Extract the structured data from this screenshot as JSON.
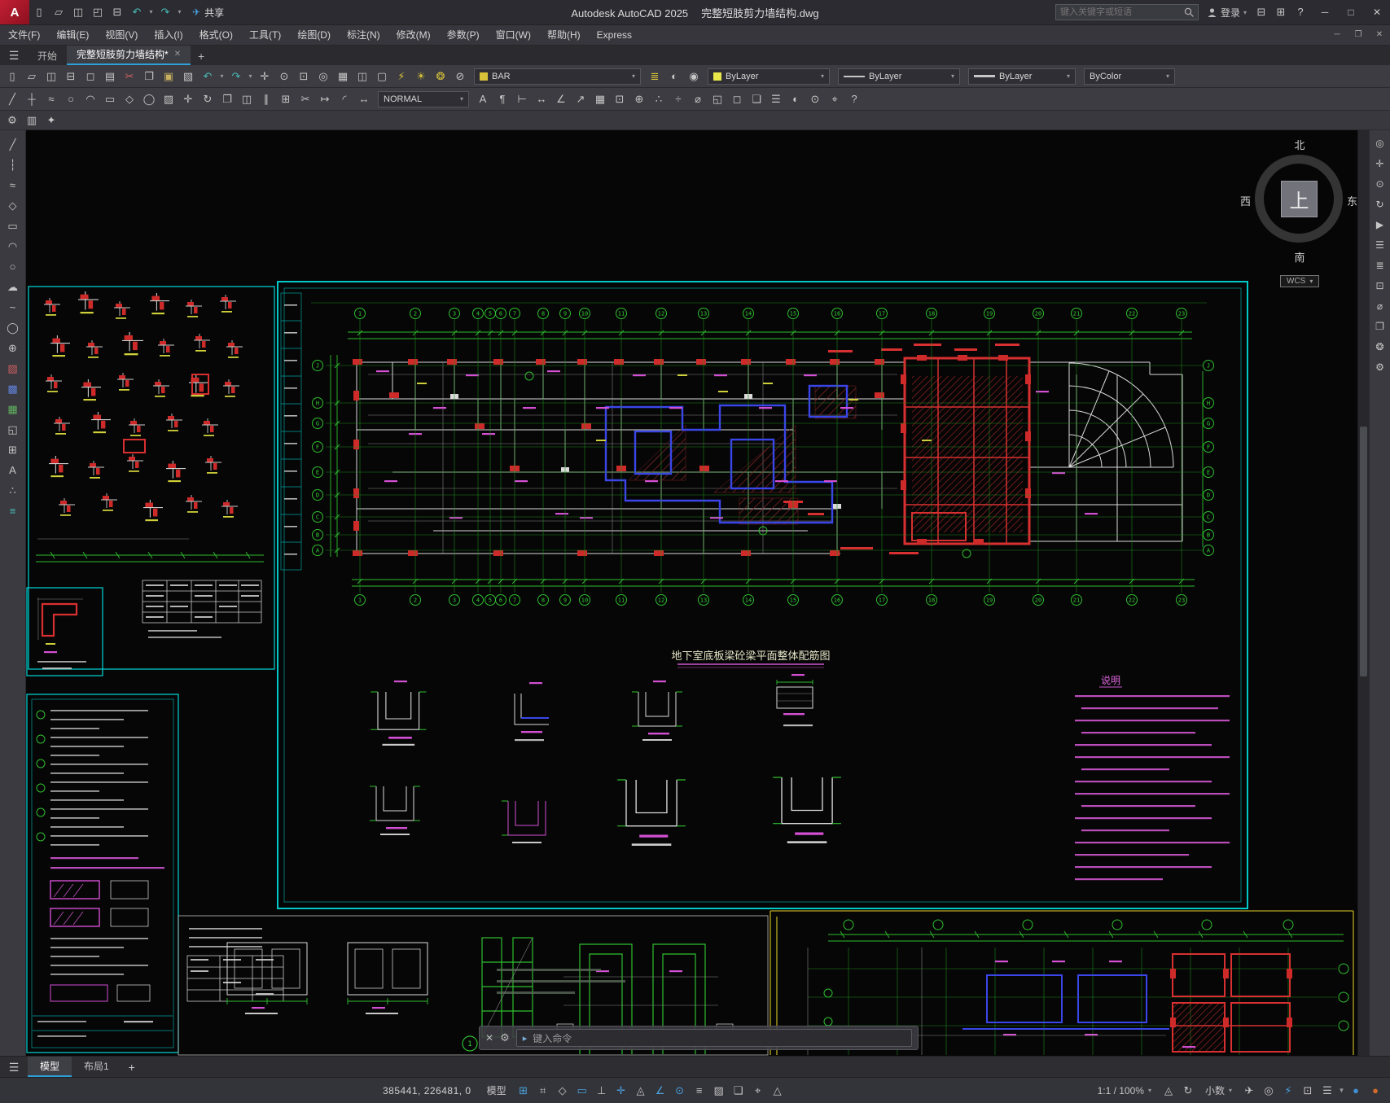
{
  "titlebar": {
    "logo": "A",
    "app_title": "Autodesk AutoCAD 2025",
    "doc_title": "完整短肢剪力墙结构.dwg",
    "share": "共享",
    "search_placeholder": "键入关键字或短语",
    "signin": "登录",
    "quick_icons": [
      {
        "name": "new-file-icon",
        "glyph": "▯"
      },
      {
        "name": "open-file-icon",
        "glyph": "▱"
      },
      {
        "name": "save-icon",
        "glyph": "◫"
      },
      {
        "name": "save-as-icon",
        "glyph": "◰"
      },
      {
        "name": "plot-icon",
        "glyph": "⊟"
      },
      {
        "name": "undo-icon",
        "glyph": "↶",
        "color": "#49b8b4"
      },
      {
        "name": "undo-dropdown-icon",
        "glyph": "▾",
        "small": true
      },
      {
        "name": "redo-icon",
        "glyph": "↷",
        "color": "#49b8b4"
      },
      {
        "name": "redo-dropdown-icon",
        "glyph": "▾",
        "small": true
      }
    ],
    "right_icons": [
      {
        "name": "cart-icon",
        "glyph": "⊟"
      },
      {
        "name": "apps-icon",
        "glyph": "⊞"
      },
      {
        "name": "help-icon",
        "glyph": "?"
      }
    ],
    "window_controls": [
      {
        "name": "minimize-button",
        "glyph": "─"
      },
      {
        "name": "maximize-button",
        "glyph": "□"
      },
      {
        "name": "close-button",
        "glyph": "✕"
      }
    ]
  },
  "menubar": {
    "items": [
      "文件(F)",
      "编辑(E)",
      "视图(V)",
      "插入(I)",
      "格式(O)",
      "工具(T)",
      "绘图(D)",
      "标注(N)",
      "修改(M)",
      "参数(P)",
      "窗口(W)",
      "帮助(H)",
      "Express"
    ],
    "window_controls": [
      {
        "name": "doc-minimize-button",
        "glyph": "─"
      },
      {
        "name": "doc-restore-button",
        "glyph": "❐"
      },
      {
        "name": "doc-close-button",
        "glyph": "✕"
      }
    ]
  },
  "doctabs": {
    "start_tab": "开始",
    "drawing_tab": "完整短肢剪力墙结构*",
    "close_glyph": "✕",
    "new_tab_glyph": "+"
  },
  "ribbon": {
    "row1_a": [
      {
        "name": "qnew-icon",
        "glyph": "▯"
      },
      {
        "name": "open-icon",
        "glyph": "▱"
      },
      {
        "name": "save-file-icon",
        "glyph": "◫"
      },
      {
        "name": "plot-icon",
        "glyph": "⊟"
      },
      {
        "name": "plot-preview-icon",
        "glyph": "◻"
      },
      {
        "name": "publish-icon",
        "glyph": "▤"
      },
      {
        "name": "cut-icon",
        "glyph": "✂",
        "color": "#d06060"
      },
      {
        "name": "copy-icon",
        "glyph": "❐"
      },
      {
        "name": "paste-icon",
        "glyph": "▣",
        "color": "#c8b060"
      },
      {
        "name": "match-properties-icon",
        "glyph": "▧"
      },
      {
        "name": "undo-icon",
        "glyph": "↶",
        "color": "#49b8b4"
      },
      {
        "name": "undo-list-icon",
        "glyph": "▾",
        "small": true
      },
      {
        "name": "redo-icon",
        "glyph": "↷",
        "color": "#49b8b4"
      },
      {
        "name": "redo-list-icon",
        "glyph": "▾",
        "small": true
      },
      {
        "name": "pan-icon",
        "glyph": "✛"
      },
      {
        "name": "zoom-realtime-icon",
        "glyph": "⊙"
      },
      {
        "name": "zoom-window-icon",
        "glyph": "⊡"
      },
      {
        "name": "zoom-previous-icon",
        "glyph": "◎"
      },
      {
        "name": "named-views-icon",
        "glyph": "▦"
      },
      {
        "name": "viewports-icon",
        "glyph": "◫"
      },
      {
        "name": "hide-icon",
        "glyph": "▢"
      },
      {
        "name": "render-icon",
        "glyph": "⚡",
        "color": "#d8c23a"
      },
      {
        "name": "sun-properties-icon",
        "glyph": "☀",
        "color": "#d8c23a"
      },
      {
        "name": "materials-icon",
        "glyph": "❂",
        "color": "#d8c23a"
      },
      {
        "name": "lock-ui-icon",
        "glyph": "⊘"
      }
    ],
    "bar_combo": {
      "label": "BAR"
    },
    "row1_b": [
      {
        "name": "layer-properties-icon",
        "glyph": "≣",
        "color": "#d8c23a"
      },
      {
        "name": "layer-states-icon",
        "glyph": "◐"
      },
      {
        "name": "layer-isolate-icon",
        "glyph": "◉"
      }
    ],
    "layer_combo": {
      "label": "ByLayer"
    },
    "linetype_combo": {
      "label": "ByLayer"
    },
    "lineweight_combo": {
      "label": "ByLayer"
    },
    "plotstyle_combo": {
      "label": "ByColor"
    },
    "row2_a": [
      {
        "name": "line-icon",
        "glyph": "╱"
      },
      {
        "name": "construction-line-icon",
        "glyph": "┼"
      },
      {
        "name": "polyline-icon",
        "glyph": "≈"
      },
      {
        "name": "circle-icon",
        "glyph": "○"
      },
      {
        "name": "arc-icon",
        "glyph": "◠"
      },
      {
        "name": "rectangle-icon",
        "glyph": "▭"
      },
      {
        "name": "polygon-icon",
        "glyph": "◇"
      },
      {
        "name": "ellipse-icon",
        "glyph": "◯"
      },
      {
        "name": "hatch-icon",
        "glyph": "▨"
      },
      {
        "name": "move-icon",
        "glyph": "✛"
      },
      {
        "name": "rotate-icon",
        "glyph": "↻"
      },
      {
        "name": "copy-object-icon",
        "glyph": "❐"
      },
      {
        "name": "mirror-icon",
        "glyph": "◫"
      },
      {
        "name": "offset-icon",
        "glyph": "∥"
      },
      {
        "name": "array-icon",
        "glyph": "⊞"
      },
      {
        "name": "trim-icon",
        "glyph": "✂"
      },
      {
        "name": "extend-icon",
        "glyph": "↦"
      },
      {
        "name": "fillet-icon",
        "glyph": "◜"
      },
      {
        "name": "scale-icon",
        "glyph": "↔"
      }
    ],
    "textstyle_combo": {
      "label": "NORMAL"
    },
    "row2_b": [
      {
        "name": "text-icon",
        "glyph": "A"
      },
      {
        "name": "mtext-icon",
        "glyph": "¶"
      },
      {
        "name": "linear-dimension-icon",
        "glyph": "⊢"
      },
      {
        "name": "aligned-dimension-icon",
        "glyph": "↔"
      },
      {
        "name": "angular-dimension-icon",
        "glyph": "∠"
      },
      {
        "name": "leader-icon",
        "glyph": "↗"
      },
      {
        "name": "table-icon",
        "glyph": "▦"
      },
      {
        "name": "block-icon",
        "glyph": "⊡"
      },
      {
        "name": "insert-icon",
        "glyph": "⊕"
      },
      {
        "name": "point-icon",
        "glyph": "∴"
      },
      {
        "name": "divide-icon",
        "glyph": "÷"
      },
      {
        "name": "measure-icon",
        "glyph": "⌀"
      },
      {
        "name": "region-icon",
        "glyph": "◱"
      },
      {
        "name": "boundary-icon",
        "glyph": "◻"
      },
      {
        "name": "group-icon",
        "glyph": "❏"
      },
      {
        "name": "properties-icon",
        "glyph": "☰"
      },
      {
        "name": "layer-walk-icon",
        "glyph": "◐"
      },
      {
        "name": "osnap-settings-icon",
        "glyph": "⊙"
      },
      {
        "name": "ucs-icon",
        "glyph": "⌖"
      },
      {
        "name": "help-tool-icon",
        "glyph": "?"
      }
    ],
    "row3": [
      {
        "name": "workspace-icon",
        "glyph": "⚙"
      },
      {
        "name": "palettes-icon",
        "glyph": "▥"
      },
      {
        "name": "clean-screen-icon",
        "glyph": "✦"
      }
    ]
  },
  "left_palette": [
    {
      "name": "line-tool-icon",
      "glyph": "╱"
    },
    {
      "name": "xline-tool-icon",
      "glyph": "┆"
    },
    {
      "name": "polyline-tool-icon",
      "glyph": "≈"
    },
    {
      "name": "polygon-tool-icon",
      "glyph": "◇"
    },
    {
      "name": "rectangle-tool-icon",
      "glyph": "▭"
    },
    {
      "name": "arc-tool-icon",
      "glyph": "◠"
    },
    {
      "name": "circle-tool-icon",
      "glyph": "○"
    },
    {
      "name": "revcloud-tool-icon",
      "glyph": "☁"
    },
    {
      "name": "spline-tool-icon",
      "glyph": "~"
    },
    {
      "name": "ellipse-tool-icon",
      "glyph": "◯"
    },
    {
      "name": "insert-block-tool-icon",
      "glyph": "⊕"
    },
    {
      "name": "hatch-tool-icon",
      "glyph": "▨",
      "color": "#d06060"
    },
    {
      "name": "gradient-tool-icon",
      "glyph": "▩",
      "color": "#6080d8"
    },
    {
      "name": "boundary-tool-icon",
      "glyph": "▦",
      "color": "#60b060"
    },
    {
      "name": "region-tool-icon",
      "glyph": "◱"
    },
    {
      "name": "table-tool-icon",
      "glyph": "⊞"
    },
    {
      "name": "mtext-tool-icon",
      "glyph": "A"
    },
    {
      "name": "point-tool-icon",
      "glyph": "∴"
    },
    {
      "name": "divide-tool-icon",
      "glyph": "≡",
      "color": "#49b8b4"
    }
  ],
  "right_panel": [
    {
      "name": "navigation-wheel-icon",
      "glyph": "◎"
    },
    {
      "name": "pan-tool-icon",
      "glyph": "✛"
    },
    {
      "name": "zoom-extents-icon",
      "glyph": "⊙"
    },
    {
      "name": "orbit-icon",
      "glyph": "↻"
    },
    {
      "name": "showmotion-icon",
      "glyph": "▶"
    },
    {
      "name": "properties-panel-icon",
      "glyph": "☰"
    },
    {
      "name": "layers-panel-icon",
      "glyph": "≣"
    },
    {
      "name": "blocks-panel-icon",
      "glyph": "⊡"
    },
    {
      "name": "measure-panel-icon",
      "glyph": "⌀"
    },
    {
      "name": "xref-panel-icon",
      "glyph": "❐"
    },
    {
      "name": "render-panel-icon",
      "glyph": "❂"
    },
    {
      "name": "settings-panel-icon",
      "glyph": "⚙"
    }
  ],
  "compass": {
    "north": "北",
    "south": "南",
    "west": "西",
    "east": "东",
    "up": "上",
    "wcs": "WCS"
  },
  "drawing": {
    "plan_title": "地下室底板梁砼梁平面整体配筋图",
    "notes_title": "说明",
    "callout_number": "1",
    "axes": {
      "v_labels": [
        "1",
        "2",
        "3",
        "4",
        "5",
        "6",
        "7",
        "8",
        "9",
        "10",
        "11",
        "12",
        "13",
        "14",
        "15",
        "16",
        "17",
        "18",
        "19",
        "20",
        "21",
        "22",
        "23"
      ],
      "h_labels": [
        "A",
        "B",
        "C",
        "D",
        "E",
        "F",
        "G",
        "H",
        "J"
      ]
    }
  },
  "command": {
    "placeholder": "键入命令"
  },
  "layout_tabs": {
    "model": "模型",
    "layout1": "布局1",
    "add_glyph": "+"
  },
  "statusbar": {
    "coords": "385441, 226481, 0",
    "model_label": "模型",
    "scale_label": "1:1 / 100%",
    "units_label": "小数",
    "left_icons": [
      {
        "name": "grid-toggle-icon",
        "glyph": "⊞",
        "active": true
      },
      {
        "name": "snap-toggle-icon",
        "glyph": "⌗"
      },
      {
        "name": "infer-constraints-icon",
        "glyph": "◇"
      },
      {
        "name": "dynamic-input-icon",
        "glyph": "▭",
        "active": true
      },
      {
        "name": "ortho-toggle-icon",
        "glyph": "⊥"
      },
      {
        "name": "polar-tracking-icon",
        "glyph": "✛",
        "active": true
      },
      {
        "name": "isodraft-icon",
        "glyph": "◬"
      },
      {
        "name": "object-snap-tracking-icon",
        "glyph": "∠",
        "active": true
      },
      {
        "name": "object-snap-icon",
        "glyph": "⊙",
        "active": true
      },
      {
        "name": "lineweight-display-icon",
        "glyph": "≡"
      },
      {
        "name": "transparency-icon",
        "glyph": "▨"
      },
      {
        "name": "selection-cycling-icon",
        "glyph": "❏"
      },
      {
        "name": "3d-object-snap-icon",
        "glyph": "⌖"
      },
      {
        "name": "dynamic-ucs-icon",
        "glyph": "△"
      }
    ],
    "mid_icons": [
      {
        "name": "annotation-visibility-icon",
        "glyph": "◬"
      },
      {
        "name": "annotation-autoscale-icon",
        "glyph": "↻"
      }
    ],
    "right_icons": [
      {
        "name": "shared-views-icon",
        "glyph": "✈"
      },
      {
        "name": "isolate-objects-icon",
        "glyph": "◎"
      },
      {
        "name": "hardware-acceleration-icon",
        "glyph": "⚡",
        "active": true
      },
      {
        "name": "clean-screen-toggle-icon",
        "glyph": "⊡"
      },
      {
        "name": "customization-icon",
        "glyph": "☰"
      },
      {
        "name": "status-filter-icon",
        "glyph": "▼",
        "small": true
      }
    ],
    "end_icons": [
      {
        "name": "notification-bubble-icon",
        "glyph": "●",
        "color": "#3f8fd2"
      },
      {
        "name": "connect-status-icon",
        "glyph": "●",
        "color": "#d26a2a"
      }
    ]
  }
}
